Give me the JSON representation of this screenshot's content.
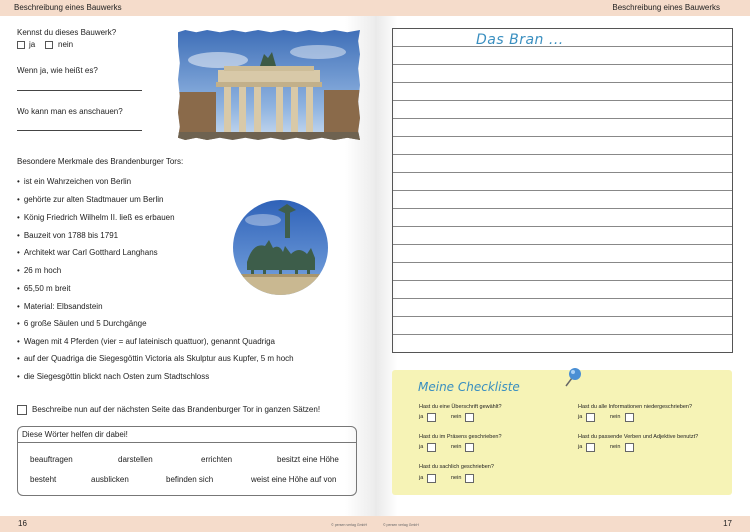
{
  "left_page": {
    "header": "Beschreibung eines Bauwerks",
    "q1": "Kennst du dieses Bauwerk?",
    "q1_yes": "ja",
    "q1_no": "nein",
    "q2": "Wenn ja, wie heißt es?",
    "q3": "Wo kann man es anschauen?",
    "features_title": "Besondere Merkmale des Brandenburger Tors:",
    "features": [
      "ist ein Wahrzeichen von Berlin",
      "gehörte zur alten Stadtmauer um Berlin",
      "König Friedrich Wilhelm II. ließ es erbauen",
      "Bauzeit von 1788 bis 1791",
      "Architekt war Carl Gotthard Langhans",
      "26 m hoch",
      "65,50 m breit",
      "Material: Elbsandstein",
      "6 große Säulen und 5 Durchgänge",
      "Wagen mit 4 Pferden (vier = auf lateinisch quattuor), genannt Quadriga",
      "auf der Quadriga die Siegesgöttin Victoria als Skulptur aus Kupfer, 5 m hoch",
      "die Siegesgöttin blickt nach Osten zum Stadtschloss"
    ],
    "task": "Beschreibe nun auf der nächsten Seite das Brandenburger Tor in ganzen Sätzen!",
    "words_title": "Diese Wörter helfen dir dabei!",
    "words_row1": [
      "beauftragen",
      "darstellen",
      "errichten",
      "besitzt eine Höhe"
    ],
    "words_row2": [
      "besteht",
      "ausblicken",
      "befinden sich",
      "weist eine Höhe auf von"
    ],
    "page_number": "16",
    "copyright": "© persen verlag GmbH"
  },
  "right_page": {
    "header": "Beschreibung eines Bauwerks",
    "handwriting": "Das Bran ...",
    "checklist_title": "Meine Checkliste",
    "checklist": [
      {
        "q": "Hast du eine Überschrift gewählt?",
        "yes": "ja",
        "no": "nein"
      },
      {
        "q": "Hast du alle Informationen niedergeschrieben?",
        "yes": "ja",
        "no": "nein"
      },
      {
        "q": "Hast du im Präsens geschrieben?",
        "yes": "ja",
        "no": "nein"
      },
      {
        "q": "Hast du passende Verben und Adjektive benutzt?",
        "yes": "ja",
        "no": "nein"
      },
      {
        "q": "Hast du sachlich geschrieben?",
        "yes": "ja",
        "no": "nein"
      }
    ],
    "page_number": "17",
    "copyright": "© persen verlag GmbH"
  },
  "colors": {
    "band": "#f5dccb",
    "note": "#f6f3b6",
    "handwriting": "#3a8fc0"
  }
}
